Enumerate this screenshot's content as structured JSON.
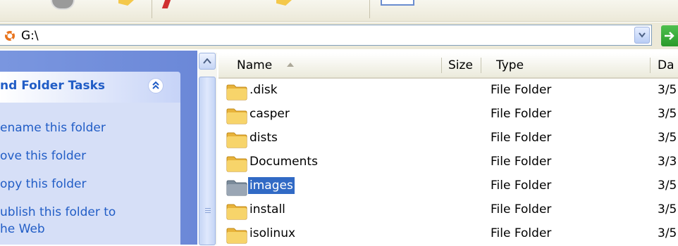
{
  "address": {
    "path": "G:\\"
  },
  "task_pane": {
    "header_title": "nd Folder Tasks",
    "links": [
      {
        "label": "ename this folder"
      },
      {
        "label": "ove this folder"
      },
      {
        "label": "opy this folder"
      },
      {
        "label": "ublish this folder to"
      },
      {
        "label": "he Web"
      }
    ]
  },
  "columns": {
    "name": "Name",
    "size": "Size",
    "type": "Type",
    "date": "Da"
  },
  "files": [
    {
      "name": ".disk",
      "type": "File Folder",
      "date": "3/5",
      "selected": false
    },
    {
      "name": "casper",
      "type": "File Folder",
      "date": "3/5",
      "selected": false
    },
    {
      "name": "dists",
      "type": "File Folder",
      "date": "3/5",
      "selected": false
    },
    {
      "name": "Documents",
      "type": "File Folder",
      "date": "3/3",
      "selected": false
    },
    {
      "name": "images",
      "type": "File Folder",
      "date": "3/5",
      "selected": true
    },
    {
      "name": "install",
      "type": "File Folder",
      "date": "3/5",
      "selected": false
    },
    {
      "name": "isolinux",
      "type": "File Folder",
      "date": "3/5",
      "selected": false
    }
  ],
  "colors": {
    "selection": "#316ac5",
    "task_link": "#215dc6",
    "task_pane_bg": "#6b88d8",
    "folder_yellow": "#f4c84a"
  }
}
